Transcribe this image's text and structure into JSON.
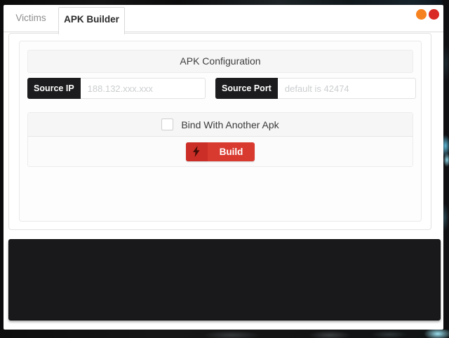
{
  "tabs": [
    {
      "label": "Victims",
      "active": false
    },
    {
      "label": "APK Builder",
      "active": true
    }
  ],
  "window_controls": [
    {
      "name": "minimize",
      "color": "#f6821f"
    },
    {
      "name": "close",
      "color": "#da2a25"
    }
  ],
  "builder": {
    "section_title": "APK Configuration",
    "source_ip": {
      "label": "Source IP",
      "placeholder": "188.132.xxx.xxx",
      "value": ""
    },
    "source_port": {
      "label": "Source Port",
      "placeholder": "default is 42474",
      "value": ""
    },
    "bind_apk": {
      "label": "Bind With Another Apk",
      "checked": false
    },
    "build": {
      "label": "Build",
      "icon": "lightning-bolt-icon"
    }
  },
  "console": {
    "text": ""
  },
  "colors": {
    "accent_red": "#d93a30",
    "accent_red_dark": "#cb2e26",
    "label_black": "#1c1c1e",
    "console_bg": "#19191c",
    "header_bg": "#f6f6f6"
  }
}
